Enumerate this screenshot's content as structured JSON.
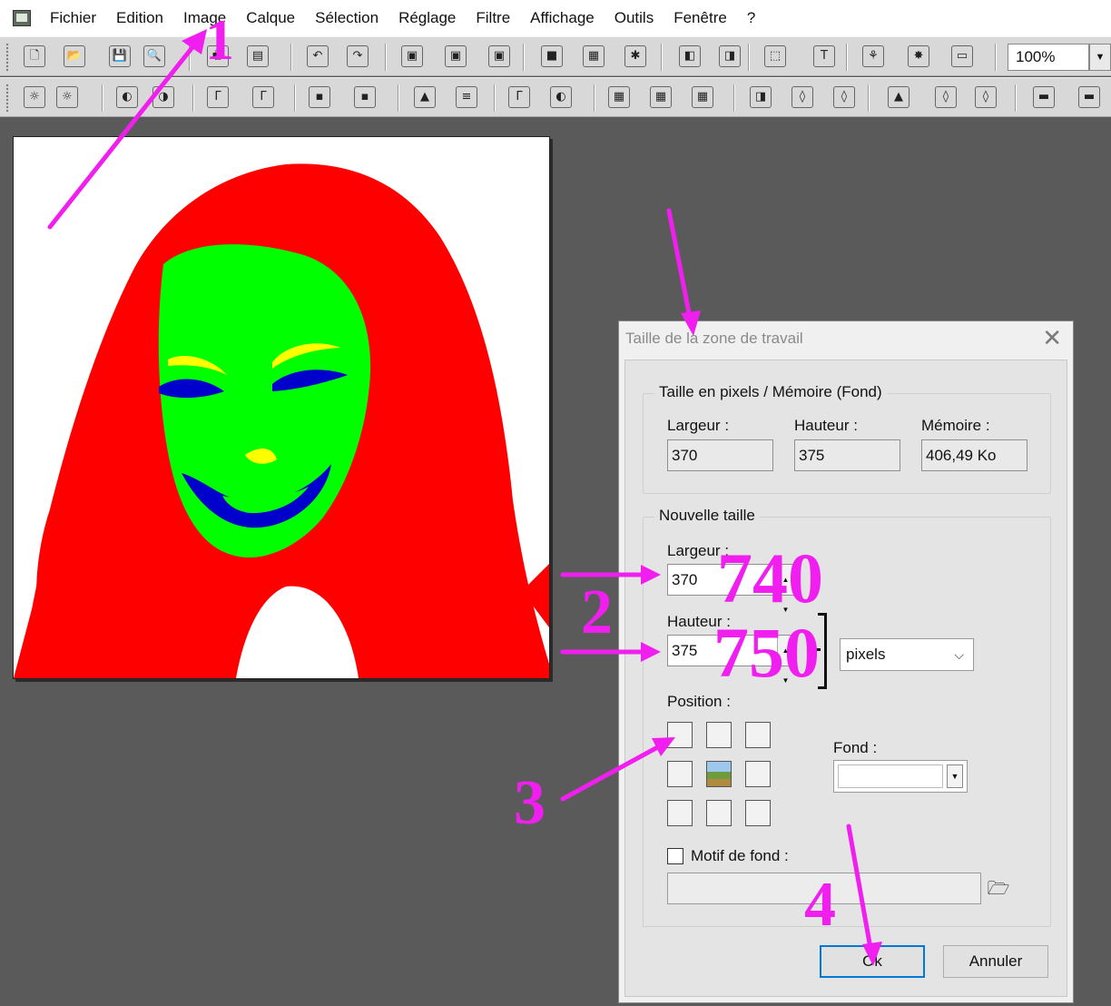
{
  "menubar": {
    "items": [
      "Fichier",
      "Edition",
      "Image",
      "Calque",
      "Sélection",
      "Réglage",
      "Filtre",
      "Affichage",
      "Outils",
      "Fenêtre",
      "?"
    ]
  },
  "toolbar": {
    "zoom_value": "100%",
    "row1_icons": [
      "new-file-icon",
      "open-folder-icon",
      "save-icon",
      "browser-icon",
      "print-icon",
      "scan-icon",
      "undo-icon",
      "redo-icon",
      "image-size-icon",
      "canvas-size-icon",
      "crop-icon",
      "gradient-icon",
      "colors-icon",
      "effect-icon",
      "layer-icon",
      "layer-move-icon",
      "selection-icon",
      "text-icon",
      "tree-icon",
      "star-icon",
      "window-icon"
    ],
    "row1_glyphs": [
      "🗋",
      "📂",
      "💾",
      "🔍",
      "🖶",
      "▤",
      "↶",
      "↷",
      "▣",
      "▣",
      "▣",
      "■",
      "▦",
      "✱",
      "◧",
      "◨",
      "⬚",
      "T",
      "⚘",
      "✸",
      "▭"
    ],
    "row2_icons": [
      "brightness-minus-icon",
      "brightness-plus-icon",
      "contrast-minus-icon",
      "contrast-plus-icon",
      "gamma-minus-icon",
      "gamma-plus-icon",
      "saturation-minus-icon",
      "saturation-plus-icon",
      "histogram-icon",
      "levels-icon",
      "gamma-auto-icon",
      "contrast-auto-icon",
      "grid-icon",
      "grid-dark-icon",
      "grid-light-icon",
      "split-icon",
      "drop-icon",
      "drops-icon",
      "mountain-icon",
      "drop-small-icon",
      "drop-outline-icon",
      "monitor-color-icon",
      "monitor-blue-icon"
    ],
    "row2_glyphs": [
      "☼",
      "☼",
      "◐",
      "◑",
      "Γ",
      "Γ",
      "▪",
      "▪",
      "▲",
      "≡",
      "Γ",
      "◐",
      "▦",
      "▦",
      "▦",
      "◨",
      "◊",
      "◊",
      "▲",
      "◊",
      "◊",
      "▬",
      "▬"
    ]
  },
  "dialog": {
    "title": "Taille de la zone de travail",
    "group_current": {
      "label": "Taille en pixels / Mémoire (Fond)",
      "width_label": "Largeur :",
      "height_label": "Hauteur :",
      "memory_label": "Mémoire :",
      "width_value": "370",
      "height_value": "375",
      "memory_value": "406,49 Ko"
    },
    "group_new": {
      "label": "Nouvelle taille",
      "width_label": "Largeur :",
      "width_value": "370",
      "height_label": "Hauteur :",
      "height_value": "375",
      "unit": "pixels",
      "position_label": "Position :",
      "fond_label": "Fond :",
      "motif_label": "Motif de fond :"
    },
    "ok_label": "Ok",
    "cancel_label": "Annuler"
  },
  "annotations": {
    "step1": "1",
    "step2": "2",
    "step3": "3",
    "step4": "4",
    "new_width": "740",
    "new_height": "750",
    "color": "#f01ff0"
  },
  "canvas": {
    "colors": {
      "hair": "#ff0000",
      "face": "#00ff00",
      "features": "#0000cc",
      "highlight": "#ffff00",
      "background": "#ffffff"
    }
  }
}
